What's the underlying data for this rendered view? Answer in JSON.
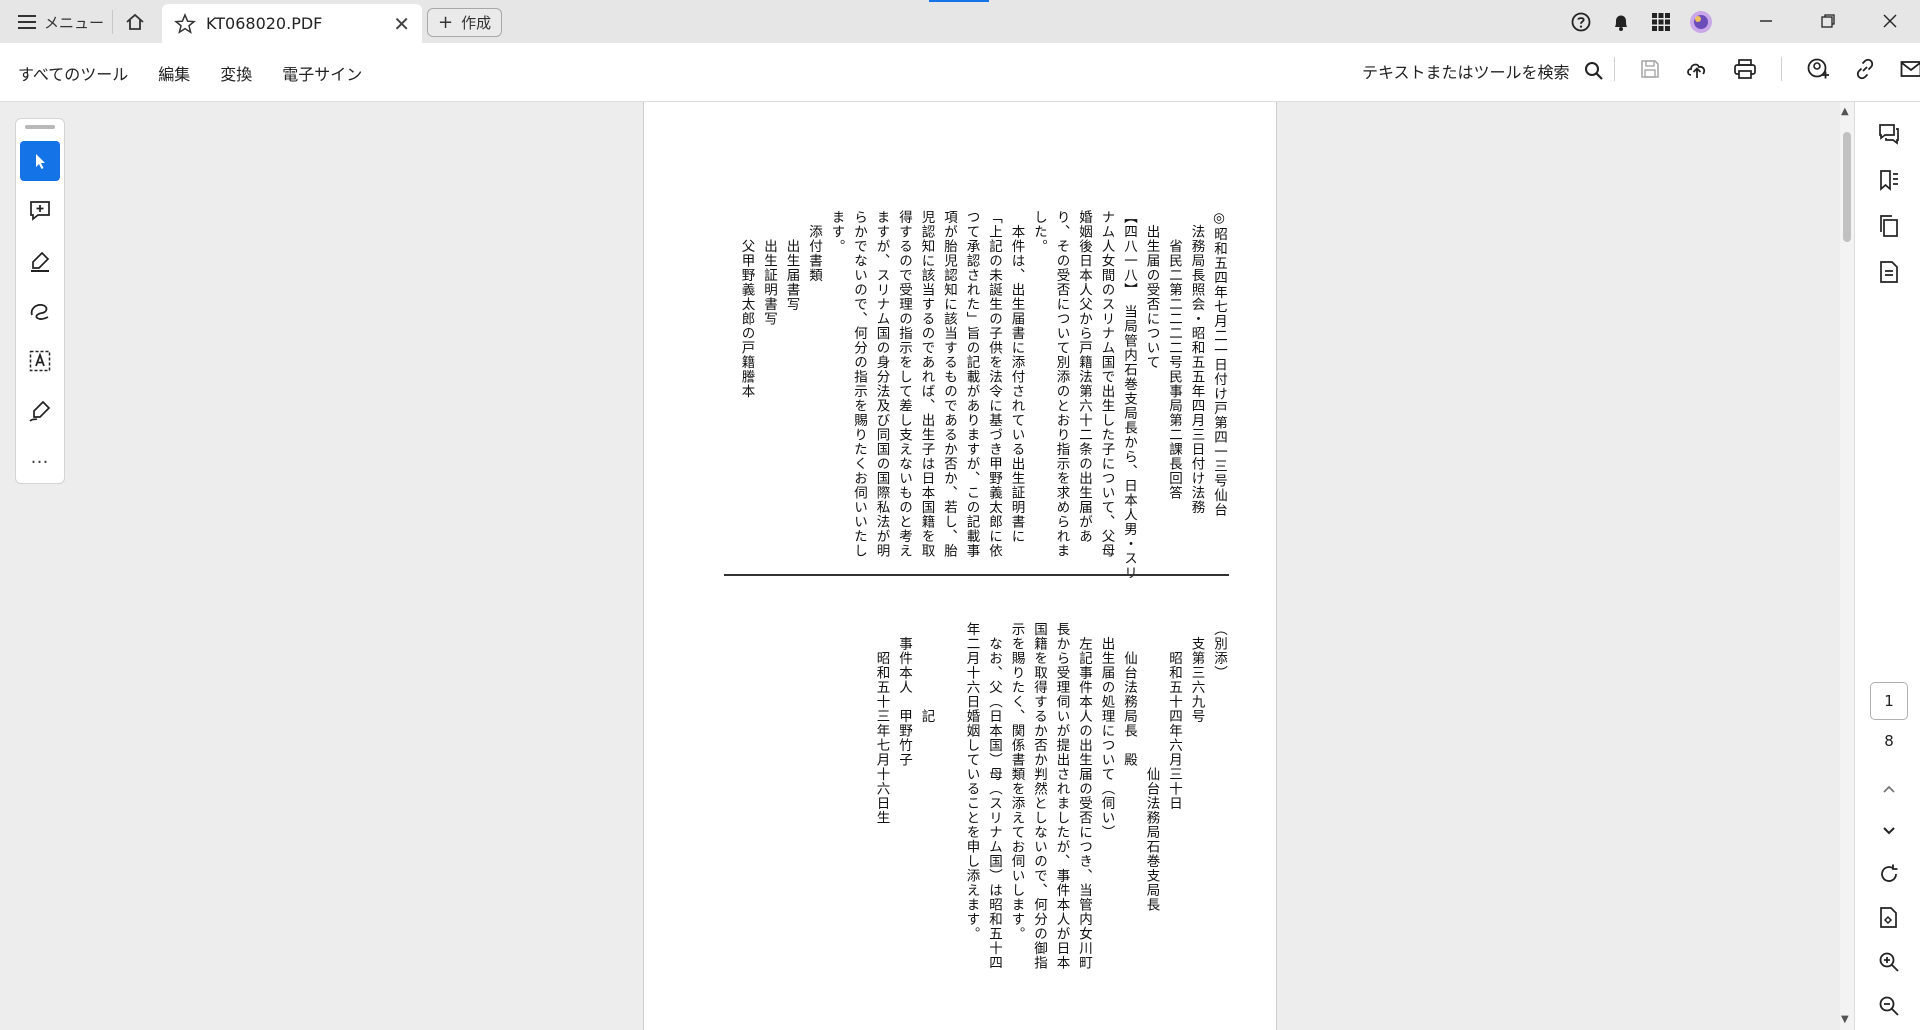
{
  "titlebar": {
    "menu_label": "メニュー",
    "tab_title": "KT068020.PDF",
    "close_glyph": "✕",
    "create_label": "作成",
    "create_glyph": "+",
    "accent_color": "#1473e6"
  },
  "toolbar": {
    "items": [
      "すべてのツール",
      "編集",
      "変換",
      "電子サイン"
    ],
    "search_label": "テキストまたはツールを検索"
  },
  "left_rail": {
    "tools": [
      "select-arrow-icon",
      "add-comment-icon",
      "highlight-pen-icon",
      "draw-freehand-icon",
      "text-box-icon",
      "sign-icon"
    ],
    "more_label": "…"
  },
  "navigation": {
    "current_page": "1",
    "total_pages": "8"
  },
  "document": {
    "upper_text": "◎昭和五四年七月二一日付け戸第四一三号仙台\n　法務局長照会・昭和五五年四月三日付け法務\n　　省民二第二二二二号民事局第二課長回答\n　出生届の受否について\n【四八一八】　当局管内石巻支局長から、日本人男・スリ\nナム人女間のスリナム国で出生した子について、父母\n婚姻後日本人父から戸籍法第六十二条の出生届があ\nり、その受否について別添のとおり指示を求められま\nした。\n　本件は、出生届書に添付されている出生証明書に\n「上記の未誕生の子供を法令に基づき甲野義太郎に依\nつて承認された」旨の記載がありますが、この記載事\n項が胎児認知に該当するものであるか否か、若し、胎\n児認知に該当するのであれば、出生子は日本国籍を取\n得するので受理の指示をして差し支えないものと考え\nますが、スリナム国の身分法及び同国の国際私法が明\nらかでないので、何分の指示を賜りたくお伺いいたし\nます。\n　添付書類\n　　出生届書写\n　　出生証明書写\n　　父甲野義太郎の戸籍謄本",
    "lower_text": "（別添）\n　支第三六九号\n　　昭和五十四年六月三十日\n　　　　　　　　　　仙台法務局石巻支局長\n　　仙台法務局長　殿\n　出生届の処理について（伺い）\n　左記事件本人の出生届の受否につき、当管内女川町\n長から受理伺いが提出されましたが、事件本人が日本\n国籍を取得するか否か判然としないので、何分の御指\n示を賜りたく、関係書類を添えてお伺いします。\n　なお、父（日本国）母（スリナム国）は昭和五十四\n年二月十六日婚姻していることを申し添えます。\n\n　　　　　　記\n　事件本人　甲野竹子\n　　昭和五十三年七月十六日生"
  }
}
